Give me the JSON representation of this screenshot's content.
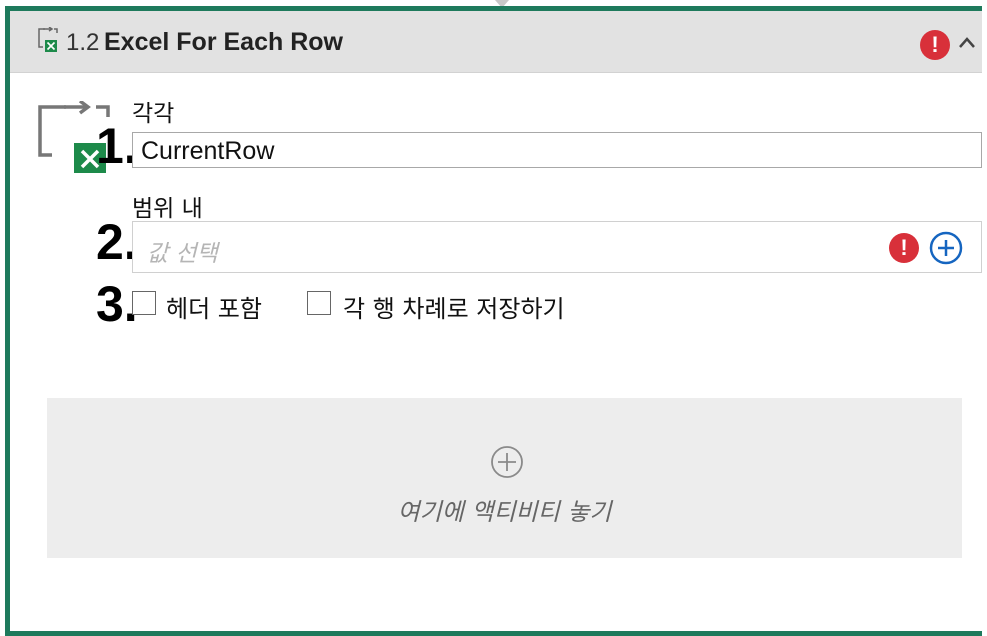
{
  "header": {
    "number": "1.2",
    "title": "Excel For Each Row",
    "error_glyph": "!",
    "icon": "excel-for-each-row-icon",
    "chevron": "chevron-up-icon"
  },
  "steps": {
    "one": "1.",
    "two": "2.",
    "three": "3."
  },
  "fields": {
    "each_label": "각각",
    "each_value": "CurrentRow",
    "range_label": "범위 내",
    "range_placeholder": "값 선택",
    "range_error_glyph": "!"
  },
  "options": {
    "include_headers": "헤더 포함",
    "include_headers_checked": false,
    "save_each_row": "각 행 차례로 저장하기",
    "save_each_row_checked": false
  },
  "drop_zone": {
    "text": "여기에 액티비티 놓기",
    "icon": "plus-circle-icon"
  },
  "colors": {
    "frame_border": "#1e7a5c",
    "error_red": "#d8303a",
    "add_blue": "#1565c0",
    "excel_green": "#1d8a4a"
  }
}
